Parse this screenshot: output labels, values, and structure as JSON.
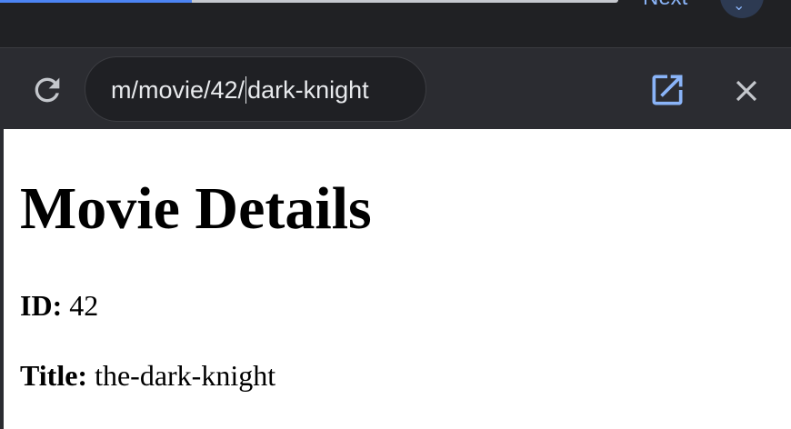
{
  "topbar": {
    "next_label": "Next",
    "next_icon": "chevron-down-icon",
    "progress": 0.31,
    "progress_color": "#4c84f4"
  },
  "toolbar": {
    "reload_icon": "reload-icon",
    "url_before_caret": "m/movie/42/",
    "url_after_caret": "dark-knight",
    "open_icon": "open-in-new-icon",
    "close_icon": "close-icon",
    "icon_accent": "#8ab4f8"
  },
  "page": {
    "heading": "Movie Details",
    "fields": [
      {
        "label": "ID:",
        "value": "42"
      },
      {
        "label": "Title:",
        "value": "the-dark-knight"
      }
    ]
  }
}
